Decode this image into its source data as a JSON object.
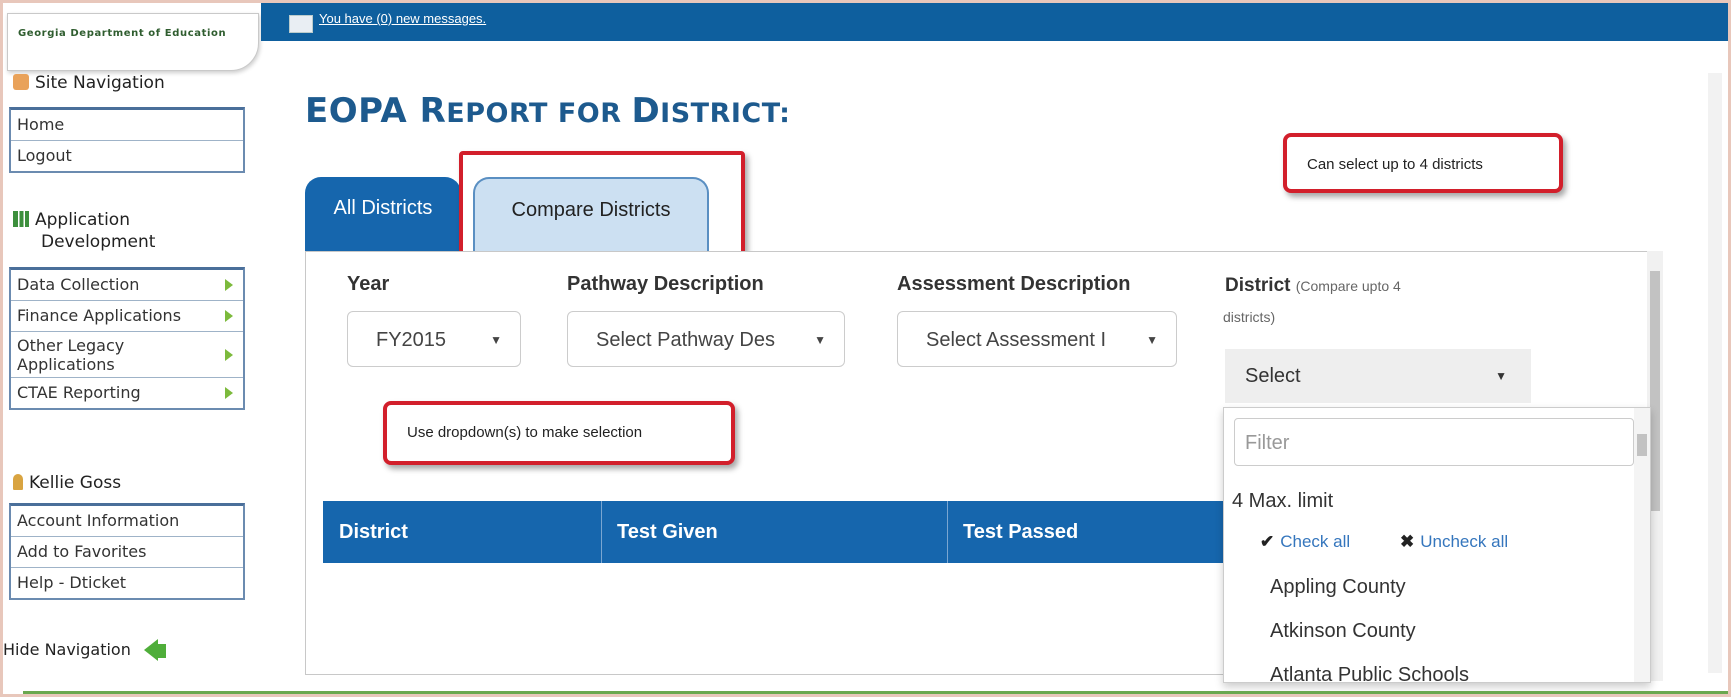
{
  "sidebar": {
    "logo_text": "Georgia Department of Education",
    "site_nav_title": "Site Navigation",
    "site_nav_items": [
      "Home",
      "Logout"
    ],
    "app_dev_title_line1": "Application",
    "app_dev_title_line2": "Development",
    "app_dev_items": [
      {
        "label": "Data Collection"
      },
      {
        "label": "Finance Applications"
      },
      {
        "label": "Other Legacy Applications"
      },
      {
        "label": "CTAE Reporting"
      }
    ],
    "user_name": "Kellie Goss",
    "user_items": [
      "Account Information",
      "Add to Favorites",
      "Help - Dticket"
    ],
    "hide_nav": "Hide Navigation"
  },
  "topbar": {
    "messages": "You have (0) new messages."
  },
  "main": {
    "title_big1": "EOPA R",
    "title_small1": "EPORT FOR ",
    "title_big2": "D",
    "title_small2": "ISTRICT:",
    "tabs": [
      "All Districts",
      "Compare Districts"
    ],
    "filters": {
      "year_label": "Year",
      "year_value": "FY2015",
      "pathway_label": "Pathway Description",
      "pathway_value": "Select Pathway Des",
      "assessment_label": "Assessment Description",
      "assessment_value": "Select Assessment I",
      "district_label": "District",
      "district_note": "(Compare upto 4",
      "district_note2": "districts)",
      "district_value": "Select"
    },
    "table_headers": [
      "District",
      "Test Given",
      "Test Passed"
    ],
    "dropdown": {
      "filter_placeholder": "Filter",
      "max_limit": "4 Max. limit",
      "check_all": "Check all",
      "uncheck_all": "Uncheck all",
      "options": [
        "Appling County",
        "Atkinson County",
        "Atlanta Public Schools"
      ]
    }
  },
  "callouts": {
    "select_up_to": "Can select up to 4 districts",
    "use_dropdowns": "Use dropdown(s) to make selection"
  },
  "colors": {
    "brand_blue": "#1666ad",
    "callout_red": "#d21f2b",
    "nav_green": "#7cba3c"
  }
}
